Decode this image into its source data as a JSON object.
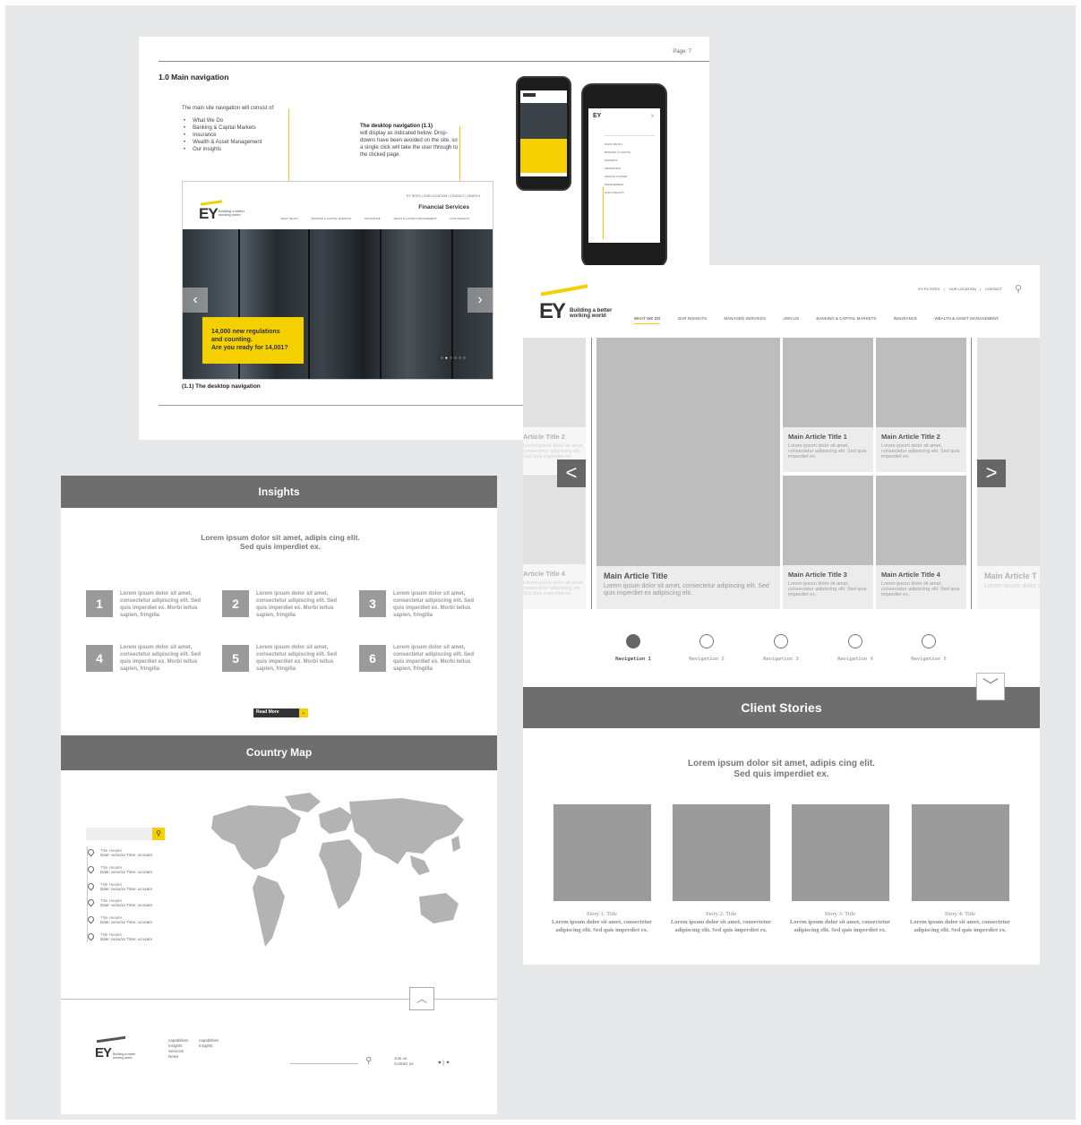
{
  "doc": {
    "page": "Page: 7",
    "title": "1.0 Main navigation",
    "intro": "The main site navigation will consist of:",
    "items": [
      "What We Do",
      "Banking & Capital Markets",
      "Insurance",
      "Wealth & Asset Management",
      "Our insights"
    ],
    "desk_title": "The desktop navigation (1.1)",
    "desk_body": "will display as indicated below. Drop-downs have been avoided on the site, so a single click will take the user through to the clicked page.",
    "caption": "(1.1) The desktop navigation",
    "mock": {
      "logo": "EY",
      "tagline": "Building a better working world",
      "top_links": "EY SITES  |  OUR LOCATION  |  CONTACT  |  SEARCH",
      "section": "Financial Services",
      "nav": [
        "WHAT WE DO",
        "BANKING & CAPITAL MARKETS",
        "INSURANCE",
        "WEALTH & ASSET MANAGEMENT",
        "OUR INSIGHTS"
      ],
      "callout": "14,000 new regulations\nand counting.\nAre you ready for 14,001?"
    }
  },
  "insights": {
    "header": "Insights",
    "lead": "Lorem ipsum dolor sit amet, adipis cing elit. Sed quis imperdiet ex.",
    "items": [
      {
        "n": "1",
        "text": "Lorem ipsum dolor sit amet, consectetur adipiscing elit. Sed quis imperdiet ex. Morbi tellus sapien, fringilla"
      },
      {
        "n": "2",
        "text": "Lorem ipsum dolor sit amet, consectetur adipiscing elit. Sed quis imperdiet ex. Morbi tellus sapien, fringilla"
      },
      {
        "n": "3",
        "text": "Lorem ipsum dolor sit amet, consectetur adipiscing elit. Sed quis imperdiet ex. Morbi tellus sapien, fringilla"
      },
      {
        "n": "4",
        "text": "Lorem ipsum dolor sit amet, consectetur adipiscing elit. Sed quis imperdiet ex. Morbi tellus sapien, fringilla"
      },
      {
        "n": "5",
        "text": "Lorem ipsum dolor sit amet, consectetur adipiscing elit. Sed quis imperdiet ex. Morbi tellus sapien, fringilla"
      },
      {
        "n": "6",
        "text": "Lorem ipsum dolor sit amet, consectetur adipiscing elit. Sed quis imperdiet ex. Morbi tellus sapien, fringilla"
      }
    ],
    "read_more": "Read More"
  },
  "map": {
    "header": "Country Map",
    "locations": [
      {
        "title": "Title Header",
        "date": "Date: xx/xx/xx Time: xx:xxam"
      },
      {
        "title": "Title Header",
        "date": "Date: xx/xx/xx Time: xx:xxam"
      },
      {
        "title": "Title Header",
        "date": "Date: xx/xx/xx Time: xx:xxam"
      },
      {
        "title": "Title Header",
        "date": "Date: xx/xx/xx Time: xx:xxam"
      },
      {
        "title": "Title Header",
        "date": "Date: xx/xx/xx Time: xx:xxam"
      },
      {
        "title": "Title Header",
        "date": "Date: xx/xx/xx Time: xx:xxam"
      }
    ]
  },
  "footer": {
    "logo": "EY",
    "tagline": "Building a better\nworking world",
    "col1": [
      "capabilities",
      "Insights",
      "Services",
      "News"
    ],
    "col2": [
      "capabilities",
      "Insights"
    ],
    "col3": [
      "Join us",
      "Contact us"
    ],
    "social": "♥  |  ✦"
  },
  "home": {
    "logo": "EY",
    "tagline": "Building a better\nworking world",
    "top_links": [
      "EY FS SITES",
      "OUR LOCATION",
      "CONTACT"
    ],
    "nav": [
      "WHAT WE DO",
      "OUR INSIGHTS",
      "MANAGED SERVICES",
      "JOIN US",
      "BANKING & CAPITAL MARKETS",
      "INSURANCE",
      "WEALTH & ASSET MANAGEMENT"
    ],
    "tiles": {
      "main": {
        "title": "Main Article Title",
        "body": "Lorem ipsum dolor sit amet, consectetur adipiscing elit. Sed quis imperdiet ex adipiscing elit."
      },
      "t1": {
        "title": "Main Article Title 1",
        "body": "Lorem ipsum dolor sit amet, consectetur adipiscing elit. Sed quis imperdiet ex."
      },
      "t2": {
        "title": "Main Article Title 2",
        "body": "Lorem ipsum dolor sit amet, consectetur adipiscing elit. Sed quis imperdiet ex."
      },
      "t3": {
        "title": "Main Article Title 3",
        "body": "Lorem ipsum dolor sit amet, consectetur adipiscing elit. Sed quis imperdiet ex."
      },
      "t4": {
        "title": "Main Article Title 4",
        "body": "Lorem ipsum dolor sit amet, consectetur adipiscing elit. Sed quis imperdiet ex."
      },
      "prev2": {
        "title": "Article Title 2",
        "body": "Lorem ipsum dolor sit amet, consectetur adipiscing elit. Sed quis imperdiet ex."
      },
      "prev4": {
        "title": "Article Title 4",
        "body": "Lorem ipsum dolor sit amet, consectetur adipiscing elit. Sed quis imperdiet ex."
      },
      "next": {
        "title": "Main Article T",
        "body": "Lorem ipsum dolor sit amet, elit. Sed quis impe"
      }
    },
    "carousel_nav": [
      "Navigation 1",
      "Navigation 2",
      "Navigation 3",
      "Navigation 4",
      "Navigation 5"
    ],
    "client_stories": "Client Stories",
    "lead": "Lorem ipsum dolor sit amet, adipis cing elit. Sed quis imperdiet ex.",
    "stories": [
      {
        "title": "Story 1: Title",
        "body": "Lorem ipsum dolor sit amet, consectetur adipiscing elit. Sed quis imperdiet ex."
      },
      {
        "title": "Story 2: Title",
        "body": "Lorem ipsum dolor sit amet, consectetur adipiscing elit. Sed quis imperdiet ex."
      },
      {
        "title": "Story 3: Title",
        "body": "Lorem ipsum dolor sit amet, consectetur adipiscing elit. Sed quis imperdiet ex."
      },
      {
        "title": "Story 4: Title",
        "body": "Lorem ipsum dolor sit amet, consectetur adipiscing elit. Sed quis imperdiet ex."
      }
    ]
  },
  "colors": {
    "accent": "#f5d000",
    "bar": "#6e6e6e",
    "tile": "#bdbdbd",
    "background": "#e7e8e9"
  }
}
